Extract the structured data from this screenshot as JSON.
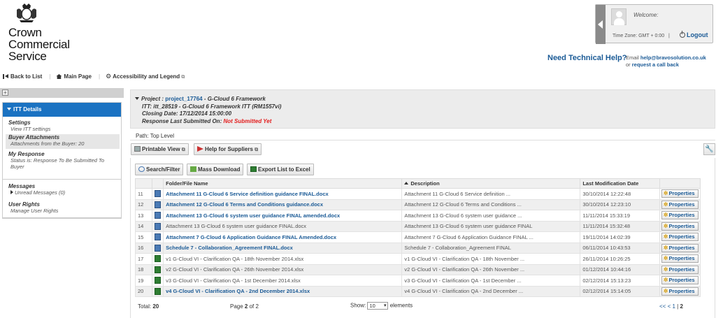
{
  "logo": {
    "lines": [
      "Crown",
      "Commercial",
      "Service"
    ]
  },
  "welcome": {
    "label": "Welcome:",
    "timezone": "Time Zone: GMT + 0:00",
    "separator": "|",
    "logout": "Logout"
  },
  "tech_help": {
    "title": "Need Technical Help?",
    "email_prefix": "Email",
    "email": "help@bravosolution.co.uk",
    "or": "or",
    "callback": "request a call back"
  },
  "topnav": {
    "back": "Back to List",
    "main": "Main Page",
    "accessibility": "Accessibility and Legend"
  },
  "sidebar": {
    "header": "ITT Details",
    "items": [
      {
        "title": "Settings",
        "sub": "View ITT settings"
      },
      {
        "title": "Buyer Attachments",
        "sub": "Attachments from the Buyer: 20"
      },
      {
        "title": "My Response",
        "sub": "Status is: Response To Be Submitted To Buyer"
      }
    ],
    "messages": {
      "title": "Messages",
      "sub": "Unread Messages (0)"
    },
    "rights": {
      "title": "User Rights",
      "sub": "Manage User Rights"
    }
  },
  "project": {
    "project_label": "Project :",
    "project_link": "project_17764",
    "project_rest": "- G-Cloud 6 Framework",
    "itt": "ITT: itt_28519 - G-Cloud 6 Framework ITT (RM1557vi)",
    "closing": "Closing Date: 17/12/2014 15:00:00",
    "response_label": "Response Last Submitted On:",
    "response_value": "Not Submitted Yet"
  },
  "path": "Path: Top Level",
  "toolbar": {
    "printable": "Printable View",
    "help_suppliers": "Help for Suppliers",
    "search": "Search/Filter",
    "mass_download": "Mass Download",
    "export": "Export List to Excel"
  },
  "table": {
    "headers": [
      "Folder/File Name",
      "Description",
      "Last Modification Date"
    ],
    "properties_label": "Properties",
    "rows": [
      {
        "num": "11",
        "type": "doc",
        "link": true,
        "name": "Attachment 11 G-Cloud 6 Service definition guidance FINAL.docx",
        "desc": "Attachment 11 G-Cloud 6 Service definition ...",
        "date": "30/10/2014 12:22:48"
      },
      {
        "num": "12",
        "type": "doc",
        "link": true,
        "name": "Attachment 12 G-Cloud 6 Terms and Conditions guidance.docx",
        "desc": "Attachment 12 G-Cloud 6 Terms and Conditions ...",
        "date": "30/10/2014 12:23:10"
      },
      {
        "num": "13",
        "type": "doc",
        "link": true,
        "name": "Attachment 13 G-Cloud 6 system user guidance FINAL amended.docx",
        "desc": "Attachment 13 G-Cloud 6 system user guidance ...",
        "date": "11/11/2014 15:33:19"
      },
      {
        "num": "14",
        "type": "doc",
        "link": false,
        "name": "Attachment 13 G-Cloud 6 system user guidance FINAL.docx",
        "desc": "Attachment 13 G-Cloud 6 system user guidance FINAL",
        "date": "11/11/2014 15:32:48"
      },
      {
        "num": "15",
        "type": "doc",
        "link": true,
        "name": "Attachment 7 G-Cloud 6 Application Guidance FINAL Amended.docx",
        "desc": "Attachment 7 G-Cloud 6 Application Guidance FINAL ...",
        "date": "19/11/2014 14:02:39"
      },
      {
        "num": "16",
        "type": "doc",
        "link": true,
        "name": "Schedule 7 - Collaboration_Agreement FINAL.docx",
        "desc": "Schedule 7 - Collaboration_Agreement FINAL",
        "date": "06/11/2014 10:43:53"
      },
      {
        "num": "17",
        "type": "xls",
        "link": false,
        "name": "v1 G-Cloud VI - Clarification QA - 18th November 2014.xlsx",
        "desc": "v1 G-Cloud VI - Clarification QA - 18th November ...",
        "date": "26/11/2014 10:26:25"
      },
      {
        "num": "18",
        "type": "xls",
        "link": false,
        "name": "v2 G-Cloud VI - Clarification QA - 26th November 2014.xlsx",
        "desc": "v2 G-Cloud VI - Clarification QA - 26th November ...",
        "date": "01/12/2014 10:44:16"
      },
      {
        "num": "19",
        "type": "xls",
        "link": false,
        "name": "v3 G-Cloud VI - Clarification QA - 1st December 2014.xlsx",
        "desc": "v3 G-Cloud VI - Clarification QA - 1st December ...",
        "date": "02/12/2014 15:13:23"
      },
      {
        "num": "20",
        "type": "xls",
        "link": true,
        "name": "v4 G-Cloud VI - Clarification QA - 2nd December 2014.xlsx",
        "desc": "v4 G-Cloud VI - Clarification QA - 2nd December ...",
        "date": "02/12/2014 15:14:05"
      }
    ]
  },
  "footer": {
    "total_label": "Total:",
    "total": "20",
    "page_label": "Page",
    "page_current": "2",
    "page_of": "of 2",
    "show_label": "Show:",
    "show_value": "10",
    "elements": "elements",
    "pager_prev": "<< <",
    "pager_1": "1",
    "pager_sep": "|",
    "pager_2": "2"
  }
}
